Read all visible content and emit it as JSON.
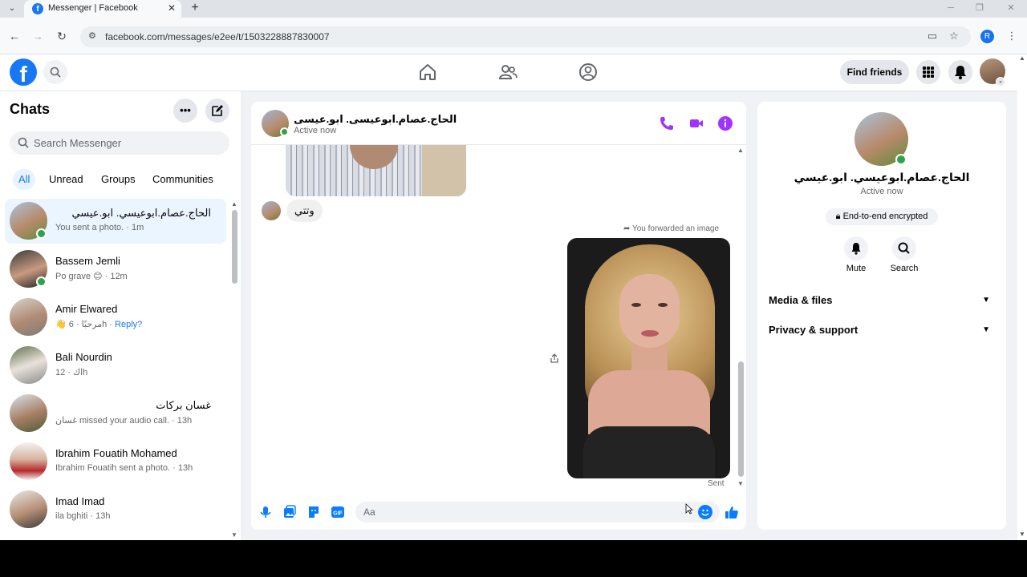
{
  "browser": {
    "tab_title": "Messenger | Facebook",
    "tab_favicon": "f",
    "tab_close": "✕",
    "new_tab": "+",
    "url": "facebook.com/messages/e2ee/t/1503228887830007",
    "profile_initial": "R"
  },
  "header": {
    "logo": "f",
    "find_friends": "Find friends"
  },
  "sidebar": {
    "title": "Chats",
    "more_label": "•••",
    "search_placeholder": "Search Messenger",
    "filters": [
      "All",
      "Unread",
      "Groups",
      "Communities"
    ],
    "chats": [
      {
        "name": "الحاج.عصام.ابوعيسي. ابو.عيسي",
        "sub": "You sent a photo. · 1m",
        "online": true,
        "selected": true
      },
      {
        "name": "Bassem Jemli",
        "sub": "Po grave 😊 · 12m",
        "online": true
      },
      {
        "name": "Amir Elwared",
        "sub": "👋 مرحبًا · 6h · ",
        "reply": "Reply?"
      },
      {
        "name": "Bali Nourdin",
        "sub": "اك · 12h"
      },
      {
        "name": "غسان بركات",
        "sub": "غسان missed your audio call. · 13h"
      },
      {
        "name": "Ibrahim Fouatih Mohamed",
        "sub": "Ibrahim Fouatih sent a photo. · 13h"
      },
      {
        "name": "Imad Imad",
        "sub": "ila bghiti · 13h"
      }
    ]
  },
  "conversation": {
    "contact_name": "الحاج.عصام.ابوعيسى. ابو.عيسى",
    "status": "Active now",
    "received_text": "وتتي",
    "forwarded_label": "You forwarded an image",
    "sent_label": "Sent",
    "composer_placeholder": "Aa"
  },
  "details": {
    "name": "الحاج.عصام.ابوعيسي. ابو.عيسي",
    "status": "Active now",
    "encryption": "End-to-end encrypted",
    "mute_label": "Mute",
    "search_label": "Search",
    "media_files": "Media & files",
    "privacy_support": "Privacy & support"
  },
  "colors": {
    "accent": "#1877f2",
    "messenger_purple": "#a033ff",
    "online_green": "#31a24c"
  }
}
